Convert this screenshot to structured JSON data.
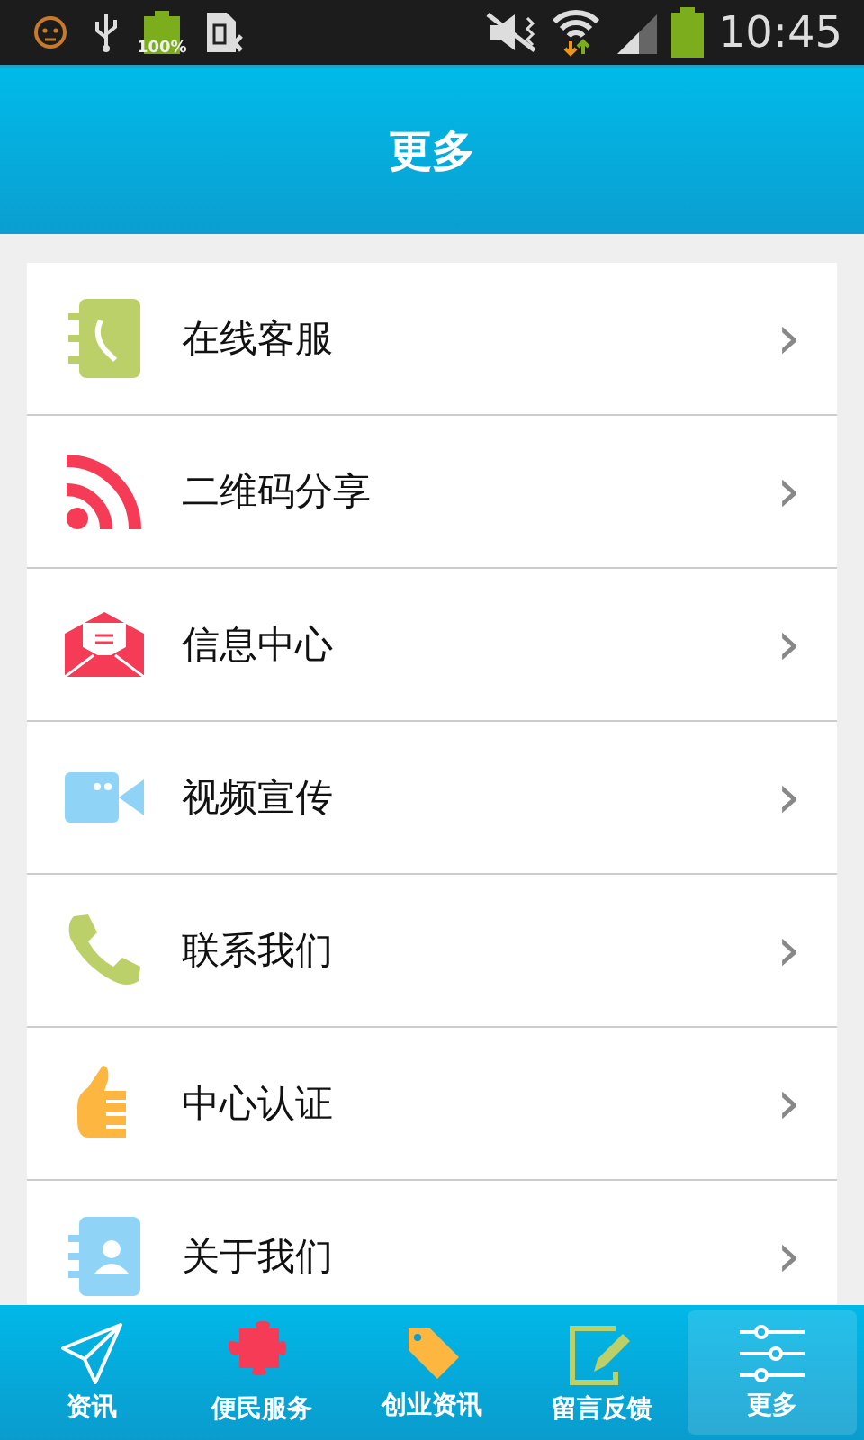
{
  "status_bar": {
    "battery_label": "100%",
    "time": "10:45"
  },
  "header": {
    "title": "更多"
  },
  "menu": [
    {
      "label": "在线客服",
      "arrow": "›"
    },
    {
      "label": "二维码分享",
      "arrow": "›"
    },
    {
      "label": "信息中心",
      "arrow": "›"
    },
    {
      "label": "视频宣传",
      "arrow": "›"
    },
    {
      "label": "联系我们",
      "arrow": "›"
    },
    {
      "label": "中心认证",
      "arrow": "›"
    },
    {
      "label": "关于我们",
      "arrow": "›"
    }
  ],
  "tab_bar": [
    {
      "label": "资讯",
      "selected": false
    },
    {
      "label": "便民服务",
      "selected": false
    },
    {
      "label": "创业资讯",
      "selected": false
    },
    {
      "label": "留言反馈",
      "selected": false
    },
    {
      "label": "更多",
      "selected": true
    }
  ]
}
